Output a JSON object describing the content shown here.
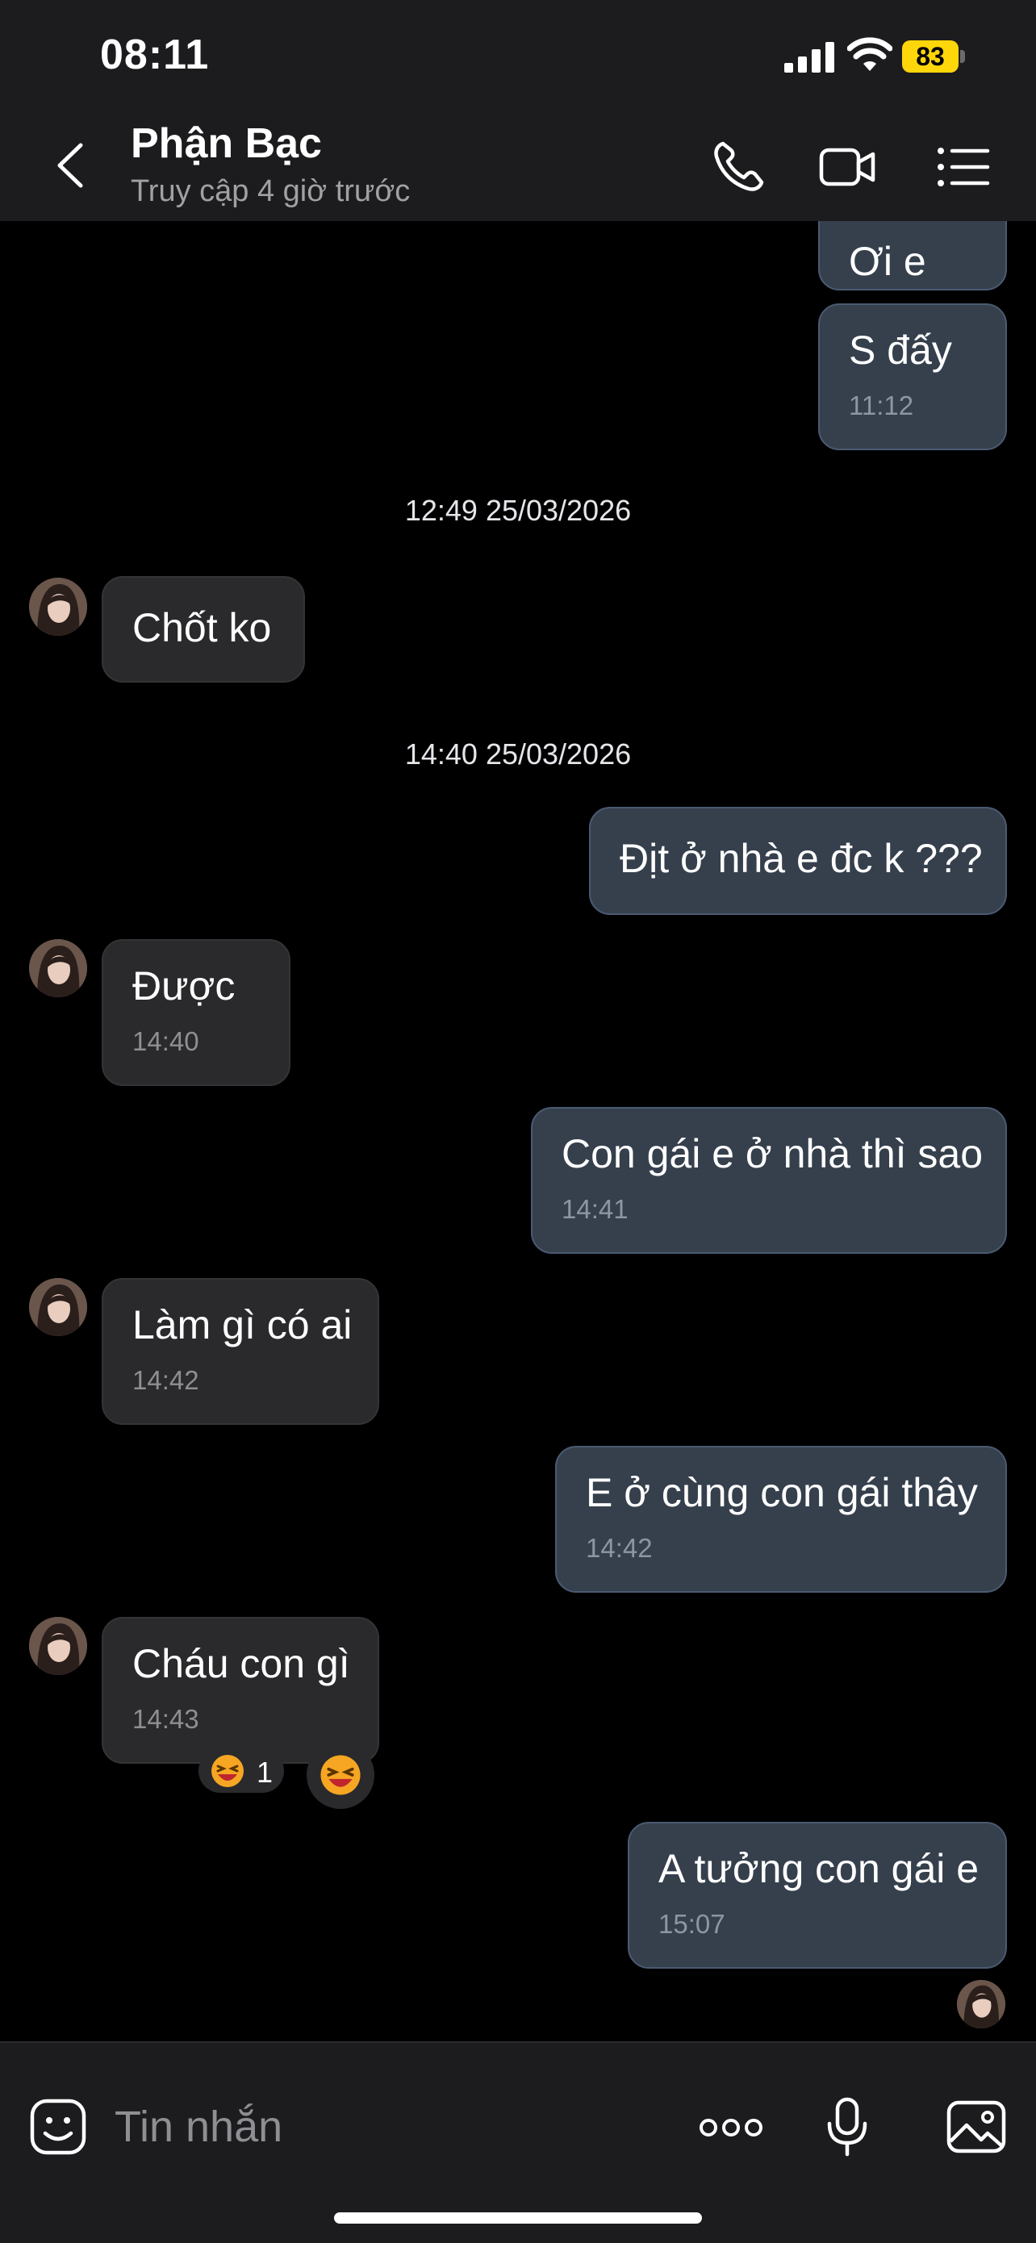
{
  "status_bar": {
    "time": "08:11",
    "battery": "83"
  },
  "header": {
    "contact_name": "Phận Bạc",
    "contact_status": "Truy cập 4 giờ trước",
    "back_icon": "chevron-left-icon",
    "call_icon": "phone-icon",
    "video_icon": "video-camera-icon",
    "menu_icon": "list-menu-icon"
  },
  "messages": [
    {
      "dir": "out",
      "text": "Ơi e"
    },
    {
      "dir": "out",
      "text": "S đấy",
      "time": "11:12"
    },
    {
      "type": "separator",
      "text": "12:49 25/03/2026"
    },
    {
      "dir": "in",
      "text": "Chốt ko"
    },
    {
      "type": "separator",
      "text": "14:40 25/03/2026"
    },
    {
      "dir": "out",
      "text": "Địt ở nhà e đc k ???"
    },
    {
      "dir": "in",
      "text": "Được",
      "time": "14:40"
    },
    {
      "dir": "out",
      "text": "Con gái e ở nhà thì sao",
      "time": "14:41"
    },
    {
      "dir": "in",
      "text": "Làm gì có ai",
      "time": "14:42"
    },
    {
      "dir": "out",
      "text": "E ở cùng con gái thây",
      "time": "14:42"
    },
    {
      "dir": "in",
      "text": "Cháu con gì",
      "time": "14:43",
      "reaction": {
        "emoji": "😆",
        "count": "1"
      }
    },
    {
      "dir": "out",
      "text": "A tưởng con gái e",
      "time": "15:07"
    }
  ],
  "input": {
    "placeholder": "Tin nhắn",
    "sticker_icon": "emoji-face-icon",
    "more_icon": "more-dots-icon",
    "mic_icon": "microphone-icon",
    "image_icon": "image-gallery-icon"
  },
  "colors": {
    "outgoing_bubble": "#36404d",
    "incoming_bubble": "#2a2a2c",
    "bar_background": "#1c1c1e",
    "battery": "#ffd60a"
  }
}
